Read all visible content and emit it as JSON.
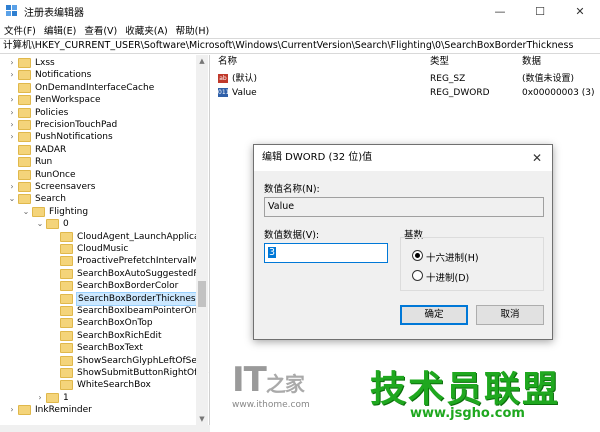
{
  "window": {
    "title": "注册表编辑器",
    "minimize_glyph": "—",
    "maximize_glyph": "☐",
    "close_glyph": "✕"
  },
  "menu": {
    "items": [
      "文件(F)",
      "编辑(E)",
      "查看(V)",
      "收藏夹(A)",
      "帮助(H)"
    ]
  },
  "address": {
    "path": "计算机\\HKEY_CURRENT_USER\\Software\\Microsoft\\Windows\\CurrentVersion\\Search\\Flighting\\0\\SearchBoxBorderThickness"
  },
  "tree": {
    "items": [
      {
        "label": "Lxss",
        "arrow": ">"
      },
      {
        "label": "Notifications",
        "arrow": ">"
      },
      {
        "label": "OnDemandInterfaceCache",
        "arrow": ""
      },
      {
        "label": "PenWorkspace",
        "arrow": ">"
      },
      {
        "label": "Policies",
        "arrow": ">"
      },
      {
        "label": "PrecisionTouchPad",
        "arrow": ">"
      },
      {
        "label": "PushNotifications",
        "arrow": ">"
      },
      {
        "label": "RADAR",
        "arrow": ""
      },
      {
        "label": "Run",
        "arrow": ""
      },
      {
        "label": "RunOnce",
        "arrow": ""
      },
      {
        "label": "Screensavers",
        "arrow": ">"
      },
      {
        "label": "Search",
        "arrow": "v"
      },
      {
        "label": "Flighting",
        "arrow": "v"
      },
      {
        "label": "0",
        "arrow": "v"
      },
      {
        "label": "CloudAgent_LaunchApplicati",
        "arrow": ""
      },
      {
        "label": "CloudMusic",
        "arrow": ""
      },
      {
        "label": "ProactivePrefetchIntervalMin",
        "arrow": ""
      },
      {
        "label": "SearchBoxAutoSuggestedFo",
        "arrow": ""
      },
      {
        "label": "SearchBoxBorderColor",
        "arrow": ""
      },
      {
        "label": "SearchBoxBorderThickness",
        "arrow": ""
      },
      {
        "label": "SearchBoxIbeamPointerOnH",
        "arrow": ""
      },
      {
        "label": "SearchBoxOnTop",
        "arrow": ""
      },
      {
        "label": "SearchBoxRichEdit",
        "arrow": ""
      },
      {
        "label": "SearchBoxText",
        "arrow": ""
      },
      {
        "label": "ShowSearchGlyphLeftOfSear",
        "arrow": ""
      },
      {
        "label": "ShowSubmitButtonRightOfSe",
        "arrow": ""
      },
      {
        "label": "WhiteSearchBox",
        "arrow": ""
      },
      {
        "label": "1",
        "arrow": ">"
      },
      {
        "label": "InkReminder",
        "arrow": ">"
      }
    ]
  },
  "list": {
    "headers": {
      "name": "名称",
      "type": "类型",
      "data": "数据"
    },
    "rows": [
      {
        "name": "(默认)",
        "type": "REG_SZ",
        "data": "(数值未设置)",
        "icon": "string-value-icon",
        "icon_text": "ab",
        "icon_color": "#c0392b"
      },
      {
        "name": "Value",
        "type": "REG_DWORD",
        "data": "0x00000003 (3)",
        "icon": "binary-value-icon",
        "icon_text": "011",
        "icon_color": "#2f5fa8"
      }
    ]
  },
  "dialog": {
    "title": "编辑 DWORD (32 位)值",
    "close_glyph": "✕",
    "name_label": "数值名称(N):",
    "name_value": "Value",
    "data_label": "数值数据(V):",
    "data_value": "3",
    "base_label": "基数",
    "hex_label": "十六进制(H)",
    "dec_label": "十进制(D)",
    "ok_label": "确定",
    "cancel_label": "取消"
  },
  "watermarks": {
    "it": "IT",
    "it_char": "之家",
    "ithome_url": "www.ithome.com",
    "big": "技术员联盟",
    "big_url": "www.jsgho.com"
  },
  "colors": {
    "selection": "#cce8ff",
    "accent": "#0078d7",
    "watermark_green": "#1fa81f"
  }
}
